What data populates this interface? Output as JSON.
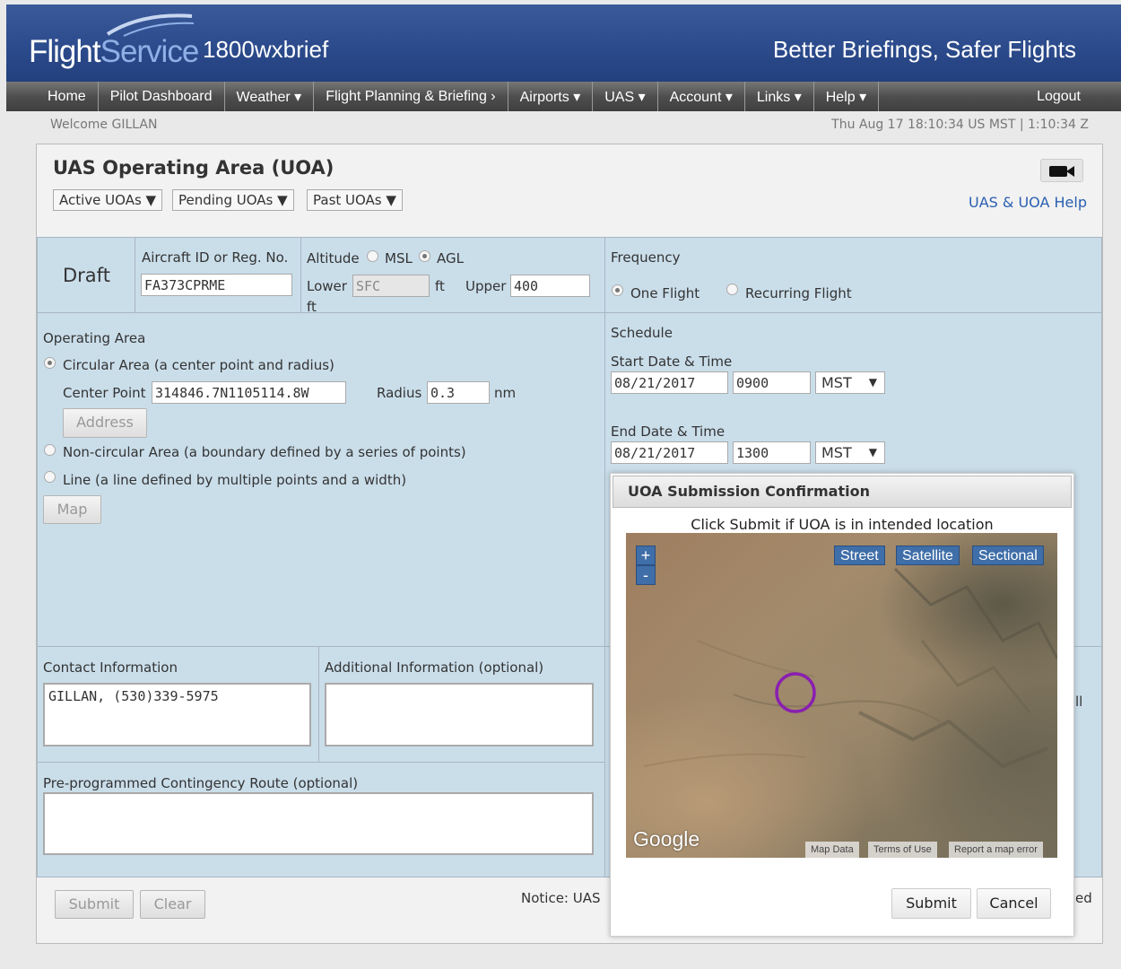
{
  "header": {
    "logo_flight": "Flight",
    "logo_service": "Service",
    "brand": "1800wxbrief",
    "slogan": "Better Briefings, Safer Flights"
  },
  "nav": {
    "items": [
      "Home",
      "Pilot Dashboard",
      "Weather ▾",
      "Flight Planning & Briefing ›",
      "Airports ▾",
      "UAS ▾",
      "Account ▾",
      "Links ▾",
      "Help ▾"
    ],
    "logout": "Logout"
  },
  "welcome": "Welcome GILLAN",
  "clock": "Thu Aug 17 18:10:34 US MST | 1:10:34 Z",
  "panel": {
    "title": "UAS Operating Area (UOA)",
    "dropdowns": [
      "Active UOAs ▼",
      "Pending UOAs ▼",
      "Past UOAs ▼"
    ],
    "help_link": "UAS & UOA Help"
  },
  "form": {
    "status": "Draft",
    "aircraft_label": "Aircraft ID or Reg. No.",
    "aircraft_value": "FA373CPRME",
    "altitude_label": "Altitude",
    "msl_label": "MSL",
    "agl_label": "AGL",
    "lower_label": "Lower",
    "lower_value": "SFC",
    "ft_label": "ft",
    "upper_label": "Upper",
    "upper_value": "400",
    "frequency_label": "Frequency",
    "one_flight": "One Flight",
    "recurring_flight": "Recurring Flight",
    "operating_area_label": "Operating Area",
    "circular_label": "Circular Area (a center point and radius)",
    "center_point_label": "Center Point",
    "center_point_value": "314846.7N1105114.8W",
    "radius_label": "Radius",
    "radius_value": "0.3",
    "nm_label": "nm",
    "address_button": "Address",
    "noncircular_label": "Non-circular Area (a boundary defined by a series of points)",
    "line_label": "Line (a line defined by multiple points and a width)",
    "map_button": "Map",
    "schedule_label": "Schedule",
    "start_label": "Start Date & Time",
    "start_date": "08/21/2017",
    "start_time": "0900",
    "start_tz": "MST",
    "end_label": "End Date & Time",
    "end_date": "08/21/2017",
    "end_time": "1300",
    "end_tz": "MST",
    "contact_label": "Contact Information",
    "contact_value": "GILLAN, (530)339-5975",
    "additional_label": "Additional Information (optional)",
    "contingency_label": "Pre-programmed Contingency Route (optional)",
    "submit_button": "Submit",
    "clear_button": "Clear",
    "notice_text": "Notice: UAS",
    "clipped_text_1": "ll",
    "clipped_text_2": "ed"
  },
  "modal": {
    "title": "UOA Submission Confirmation",
    "message": "Click Submit if UOA is in intended location",
    "map_types": [
      "Street",
      "Satellite",
      "Sectional"
    ],
    "zoom_in": "+",
    "zoom_out": "-",
    "google": "Google",
    "attribution": [
      "Map Data",
      "Terms of Use",
      "Report a map error"
    ],
    "submit_button": "Submit",
    "cancel_button": "Cancel"
  },
  "colors": {
    "header_blue": "#2c4b8c",
    "form_blue": "#cadeea",
    "link_blue": "#2a5fb0",
    "uoa_circle": "#8a1fb0"
  }
}
